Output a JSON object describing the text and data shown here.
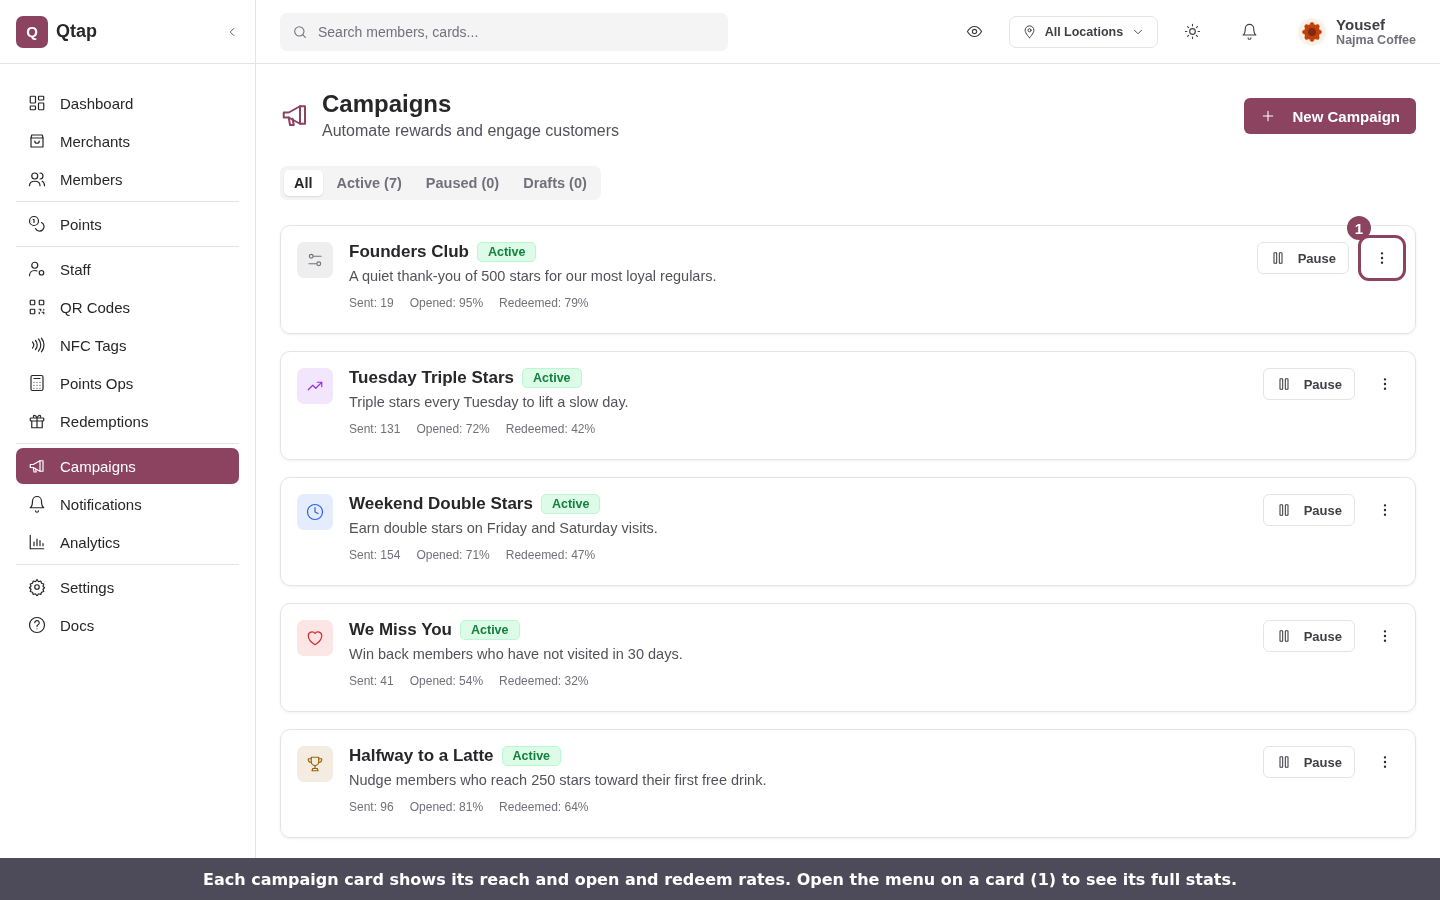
{
  "brand": {
    "logo_letter": "Q",
    "name": "Qtap"
  },
  "sidebar": {
    "groups": [
      {
        "items": [
          {
            "label": "Dashboard",
            "selected": false
          },
          {
            "label": "Merchants",
            "selected": false
          },
          {
            "label": "Members",
            "selected": false
          }
        ]
      },
      {
        "items": [
          {
            "label": "Points",
            "selected": false
          }
        ]
      },
      {
        "items": [
          {
            "label": "Staff",
            "selected": false
          },
          {
            "label": "QR Codes",
            "selected": false
          },
          {
            "label": "NFC Tags",
            "selected": false
          },
          {
            "label": "Points Ops",
            "selected": false
          },
          {
            "label": "Redemptions",
            "selected": false
          }
        ]
      },
      {
        "items": [
          {
            "label": "Campaigns",
            "selected": true
          },
          {
            "label": "Notifications",
            "selected": false
          },
          {
            "label": "Analytics",
            "selected": false
          }
        ]
      },
      {
        "items": [
          {
            "label": "Settings",
            "selected": false
          },
          {
            "label": "Docs",
            "selected": false
          }
        ]
      }
    ]
  },
  "header": {
    "search": {
      "placeholder": "Search members, cards..."
    },
    "location": "All Locations",
    "user": {
      "name": "Yousef",
      "business": "Najma Coffee"
    }
  },
  "page": {
    "title": "Campaigns",
    "subtitle": "Automate rewards and engage customers",
    "new_button": "New Campaign"
  },
  "tabs": [
    {
      "label": "All",
      "selected": true
    },
    {
      "label": "Active (7)",
      "selected": false
    },
    {
      "label": "Paused (0)",
      "selected": false
    },
    {
      "label": "Drafts (0)",
      "selected": false
    }
  ],
  "campaigns": [
    {
      "title": "Founders Club",
      "status": "Active",
      "description": "A quiet thank-you of 500 stars for our most loyal regulars.",
      "stats": [
        "Sent: 19",
        "Opened: 95%",
        "Redeemed: 79%"
      ],
      "color": "#71717a",
      "pause": "Pause",
      "menu_callout": "1"
    },
    {
      "title": "Tuesday Triple Stars",
      "status": "Active",
      "description": "Triple stars every Tuesday to lift a slow day.",
      "stats": [
        "Sent: 131",
        "Opened: 72%",
        "Redeemed: 42%"
      ],
      "color": "#9333ea",
      "pause": "Pause"
    },
    {
      "title": "Weekend Double Stars",
      "status": "Active",
      "description": "Earn double stars on Friday and Saturday visits.",
      "stats": [
        "Sent: 154",
        "Opened: 71%",
        "Redeemed: 47%"
      ],
      "color": "#2563eb",
      "pause": "Pause"
    },
    {
      "title": "We Miss You",
      "status": "Active",
      "description": "Win back members who have not visited in 30 days.",
      "stats": [
        "Sent: 41",
        "Opened: 54%",
        "Redeemed: 32%"
      ],
      "color": "#dc2626",
      "pause": "Pause"
    },
    {
      "title": "Halfway to a Latte",
      "status": "Active",
      "description": "Nudge members who reach 250 stars toward their first free drink.",
      "stats": [
        "Sent: 96",
        "Opened: 81%",
        "Redeemed: 64%"
      ],
      "color": "#a16207",
      "pause": "Pause"
    }
  ],
  "caption": "Each campaign card shows its reach and open and redeem rates. Open the menu on a card (1) to see its full stats."
}
